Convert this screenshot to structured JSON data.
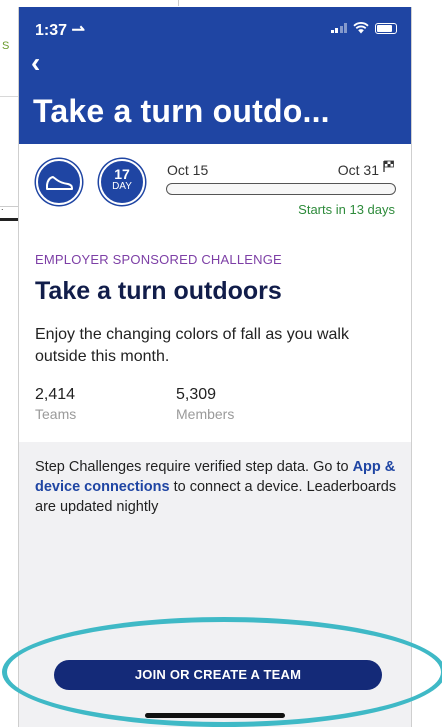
{
  "background": {
    "left_fragment_letter": "S",
    "left_fragment_dot": "."
  },
  "status_bar": {
    "time": "1:37 ⇀"
  },
  "header": {
    "back_glyph": "‹",
    "title": "Take a turn outdo..."
  },
  "challenge": {
    "day_number": "17",
    "day_label": "DAY",
    "start_date": "Oct 15",
    "end_date": "Oct 31",
    "progress": 0,
    "starts_in": "Starts in 13 days",
    "sponsor_label": "EMPLOYER SPONSORED CHALLENGE",
    "title": "Take a turn outdoors",
    "description": "Enjoy the changing colors of fall as you walk outside this month.",
    "stats": [
      {
        "value": "2,414",
        "label": "Teams"
      },
      {
        "value": "5,309",
        "label": "Members"
      }
    ]
  },
  "info": {
    "text_before": "Step Challenges require verified step data. Go to ",
    "link": "App & device connections",
    "text_after": " to connect a device. Leaderboards are updated nightly"
  },
  "join_button": "JOIN OR CREATE A TEAM",
  "colors": {
    "header_blue": "#1f45a3",
    "button_navy": "#142a78",
    "sponsor_purple": "#7d3fa6",
    "success_green": "#2e8b3b",
    "annotation_teal": "#3fb9c6"
  }
}
